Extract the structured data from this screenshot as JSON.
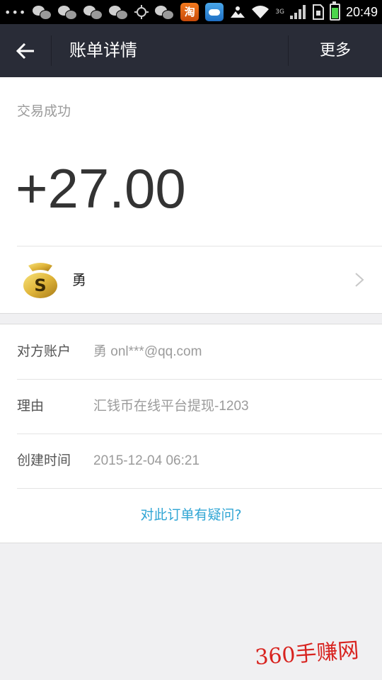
{
  "status_bar": {
    "time": "20:49",
    "network": "3G",
    "icons": [
      "more-dots-icon",
      "wechat-icon",
      "wechat-icon",
      "wechat-icon",
      "wechat-icon",
      "gps-icon",
      "wechat-icon",
      "taobao-app-icon",
      "weather-app-icon",
      "photo-icon",
      "wifi-icon",
      "signal-icon",
      "sim-icon",
      "battery-icon"
    ],
    "taobao_label": "淘"
  },
  "nav": {
    "title": "账单详情",
    "more": "更多"
  },
  "transaction": {
    "status": "交易成功",
    "amount": "+27.00",
    "payer_name": "勇"
  },
  "details": [
    {
      "label": "对方账户",
      "value": "勇 onl***@qq.com"
    },
    {
      "label": "理由",
      "value": "汇钱币在线平台提现-1203"
    },
    {
      "label": "创建时间",
      "value": "2015-12-04 06:21"
    }
  ],
  "question_link": "对此订单有疑问?",
  "watermark": "360手赚网",
  "colors": {
    "nav_bg": "#292c37",
    "link": "#2fa5d4",
    "amount": "#333333",
    "watermark": "#d8231f"
  }
}
